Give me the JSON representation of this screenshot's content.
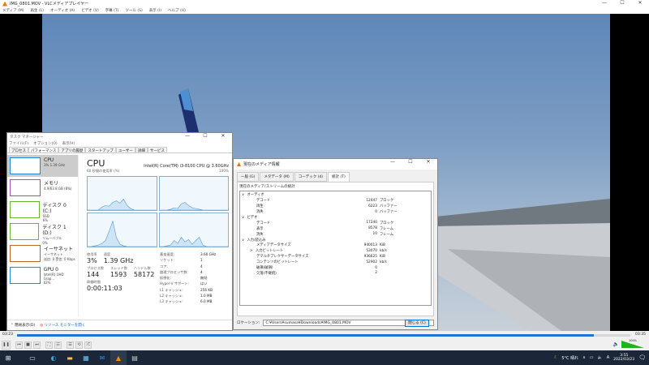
{
  "vlc": {
    "title": "IMG_0801.MOV - VLCメディアプレイヤー",
    "menu": [
      "メディア (M)",
      "再生 (L)",
      "オーディオ (A)",
      "ビデオ (V)",
      "字幕 (T)",
      "ツール (S)",
      "表示 (I)",
      "ヘルプ (H)"
    ],
    "time_elapsed": "03:23",
    "time_total": "03:35",
    "volume": "100%",
    "progress_percent": 94
  },
  "task_manager": {
    "title": "タスク マネージャー",
    "menu": [
      "ファイル(F)",
      "オプション(O)",
      "表示(V)"
    ],
    "tabs": [
      "プロセス",
      "パフォーマンス",
      "アプリの履歴",
      "スタートアップ",
      "ユーザー",
      "詳細",
      "サービス"
    ],
    "side": [
      {
        "name": "CPU",
        "sub": "3% 1.39 GHz",
        "color": "#1f8bd6"
      },
      {
        "name": "メモリ",
        "sub": "4.9/63.8 GB (8%)",
        "color": "#a04ec0"
      },
      {
        "name": "ディスク 0 (C:)",
        "sub": "SSD",
        "sub2": "6%",
        "color": "#6cb533"
      },
      {
        "name": "ディスク 1 (D:)",
        "sub": "リムーバブル",
        "sub2": "0%",
        "color": "#6cb533"
      },
      {
        "name": "イーサネット",
        "sub": "イーサネット",
        "sub2": "送信: 0 受信: 0 Kbps",
        "color": "#c1662a"
      },
      {
        "name": "GPU 0",
        "sub": "Intel(R) UHD Grap...",
        "sub2": "62%",
        "color": "#1f8bd6"
      }
    ],
    "heading": "CPU",
    "cpu_model": "Intel(R) Core(TM) i3-8100 CPU @ 3.60GHz",
    "graph_label": "60 秒間の使用率 (%)",
    "graph_max": "100%",
    "usage_label": "使用率",
    "usage": "3%",
    "speed_label": "速度",
    "speed": "1.39 GHz",
    "proc_label": "プロセス数",
    "proc": "144",
    "thread_label": "スレッド数",
    "thread": "1593",
    "handle_label": "ハンドル数",
    "handle": "58172",
    "uptime_label": "稼働時間",
    "uptime": "0:00:11:03",
    "specs": [
      [
        "基本速度:",
        "3.60 GHz"
      ],
      [
        "ソケット:",
        "1"
      ],
      [
        "コア:",
        "4"
      ],
      [
        "論理プロセッサ数:",
        "4"
      ],
      [
        "仮想化:",
        "無効"
      ],
      [
        "Hyper-V サポート:",
        "はい"
      ],
      [
        "L1 キャッシュ:",
        "256 KB"
      ],
      [
        "L2 キャッシュ:",
        "1.0 MB"
      ],
      [
        "L3 キャッシュ:",
        "6.0 MB"
      ]
    ],
    "fewer_details": "簡易表示(D)",
    "resource_monitor": "リソース モニターを開く"
  },
  "media_info": {
    "title": "現在のメディア情報",
    "tabs": [
      "一般 (G)",
      "メタデータ (M)",
      "コーデック (d)",
      "統計 (T)"
    ],
    "section": "現在のメディア/ストリームの統計",
    "rows": [
      {
        "n": "オーディオ",
        "lvl": 0,
        "arrow": "∨"
      },
      {
        "n": "デコード",
        "v": "12447",
        "u": "ブロック",
        "lvl": 1
      },
      {
        "n": "再生",
        "v": "6223",
        "u": "バッファー",
        "lvl": 1
      },
      {
        "n": "消失",
        "v": "0",
        "u": "バッファー",
        "lvl": 1
      },
      {
        "n": "ビデオ",
        "lvl": 0,
        "arrow": "∨"
      },
      {
        "n": "デコード",
        "v": "17240",
        "u": "ブロック",
        "lvl": 1
      },
      {
        "n": "表示",
        "v": "8578",
        "u": "フレーム",
        "lvl": 1
      },
      {
        "n": "消失",
        "v": "10",
        "u": "フレーム",
        "lvl": 1
      },
      {
        "n": "入力/読込み",
        "lvl": 0,
        "arrow": "∨"
      },
      {
        "n": "メディアデータサイズ",
        "v": "940013",
        "u": "KiB",
        "lvl": 1
      },
      {
        "n": "入力ビットレート",
        "v": "53070",
        "u": "kb/s",
        "lvl": 1,
        "arrow": ">"
      },
      {
        "n": "デマルチプレクサーデータサイズ",
        "v": "936625",
        "u": "KiB",
        "lvl": 1
      },
      {
        "n": "コンテンツのビットレート",
        "v": "52902",
        "u": "kb/s",
        "lvl": 1
      },
      {
        "n": "破損(破損)",
        "v": "0",
        "u": "",
        "lvl": 1
      },
      {
        "n": "欠落(不継続)",
        "v": "2",
        "u": "",
        "lvl": 1
      }
    ],
    "location_label": "ロケーション:",
    "location": "C:¥Users¥sumasa¥Downloads¥IMG_0801.MOV",
    "close": "閉じる (C)"
  },
  "taskbar": {
    "weather": "5°C 晴れ",
    "ime": "A",
    "time": "3:55",
    "date": "2022/03/23"
  }
}
